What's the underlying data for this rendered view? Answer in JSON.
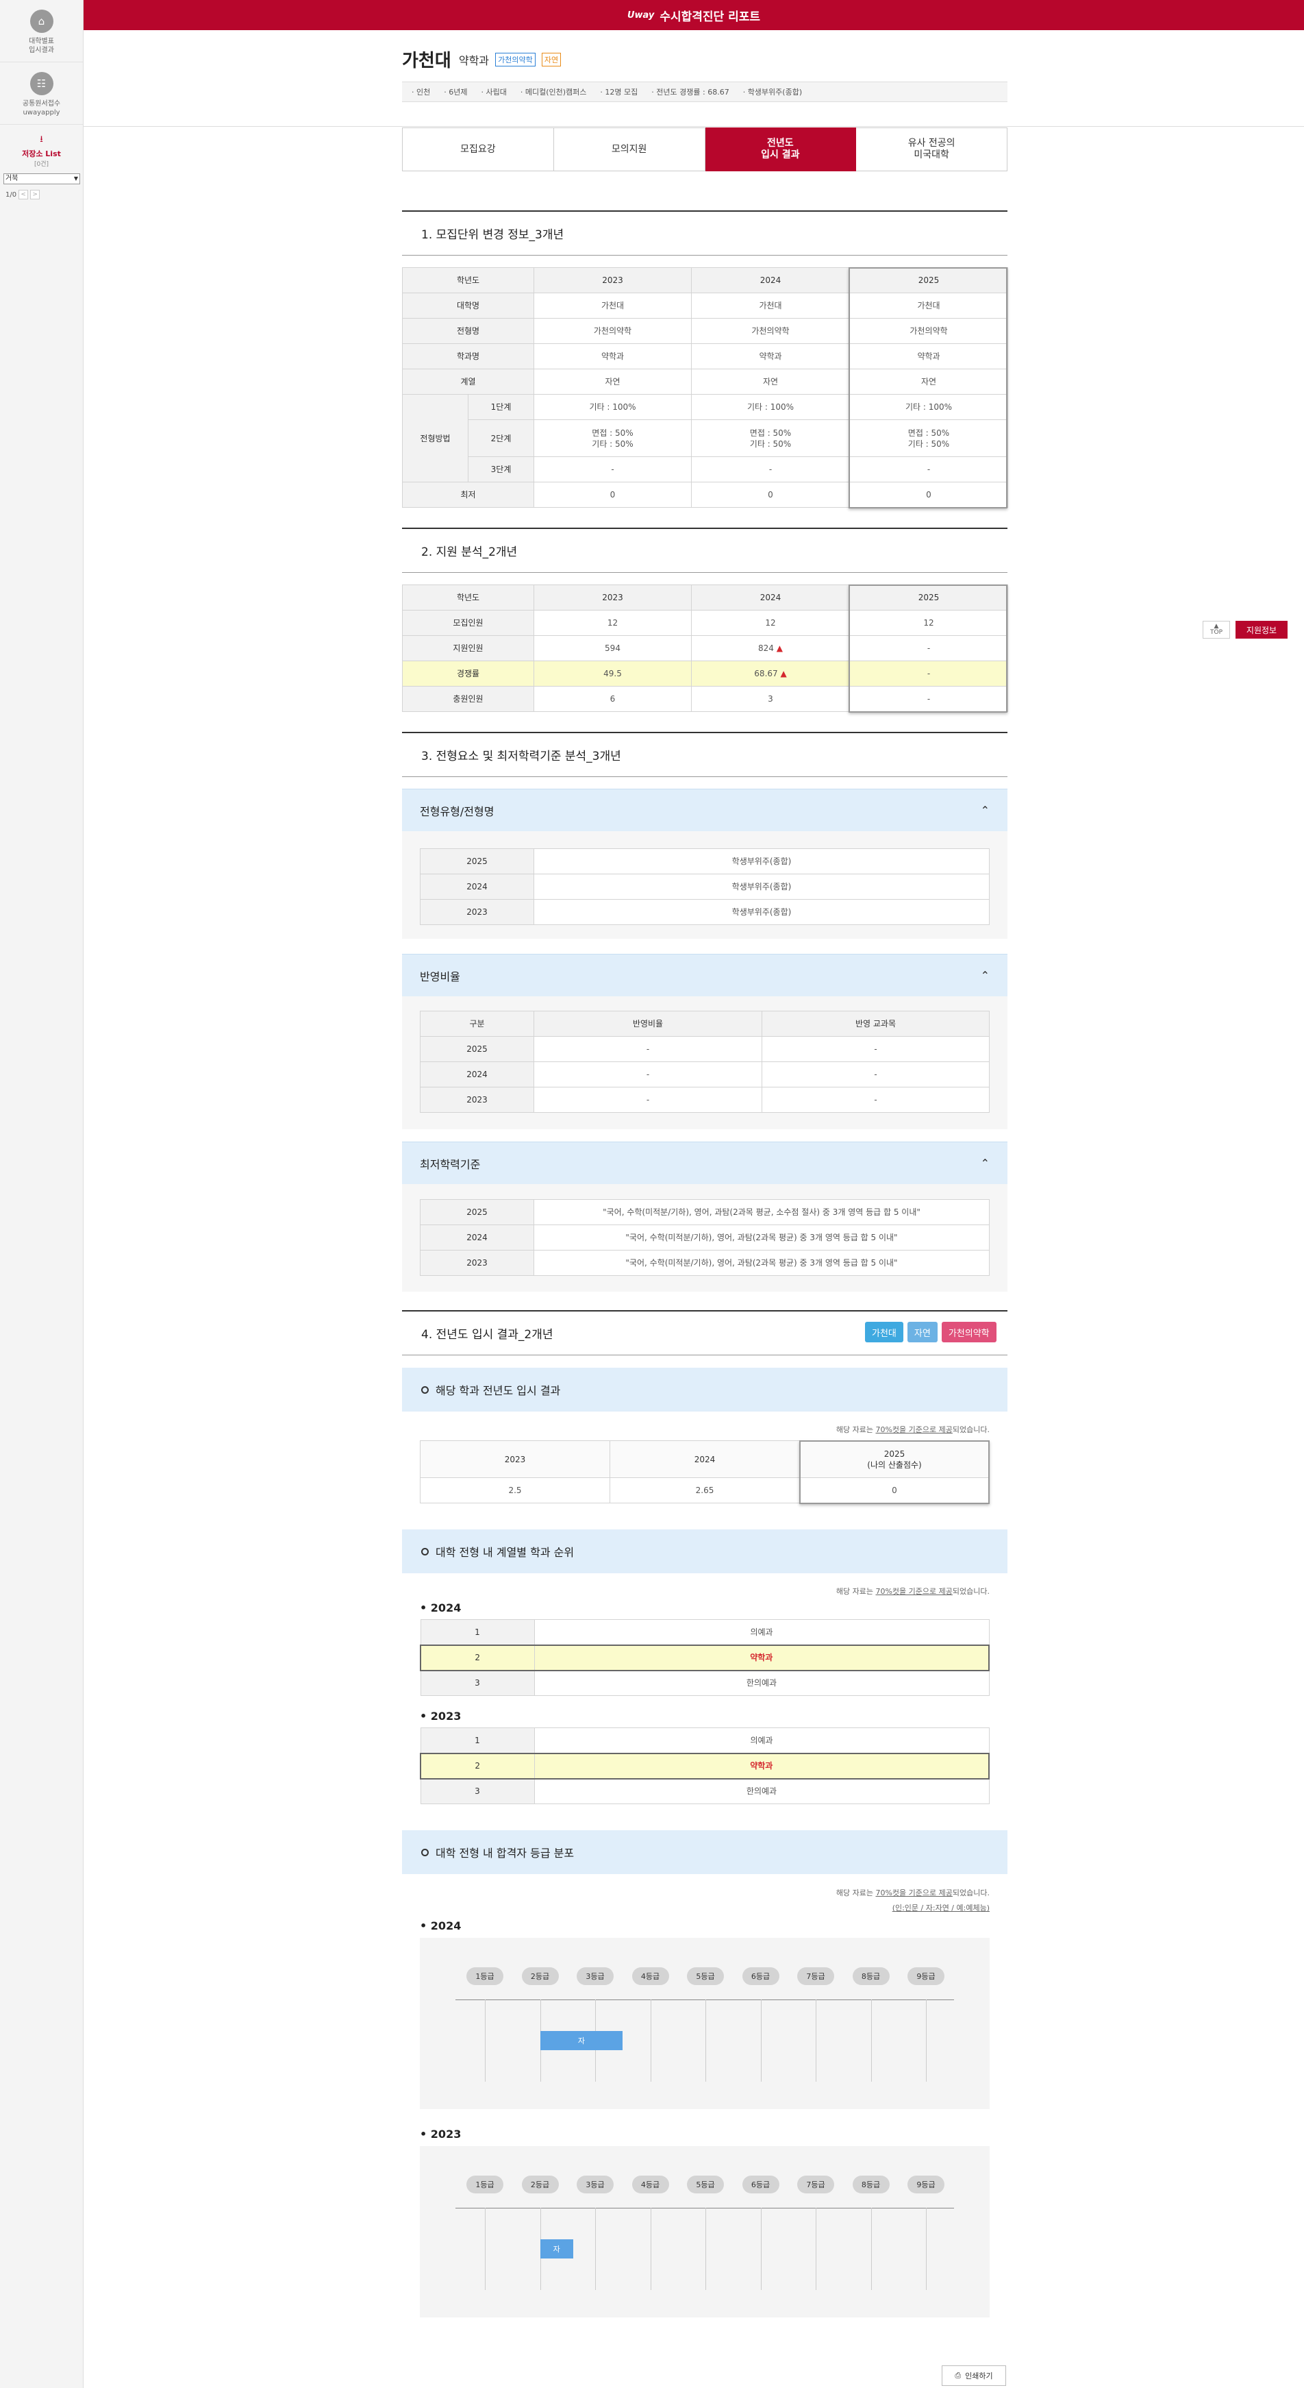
{
  "sidebar": {
    "items": [
      {
        "label": "대학별표\n입시결과",
        "icon": "school-icon"
      },
      {
        "label": "공통원서접수\nuwayapply",
        "icon": "document-icon"
      }
    ],
    "list_label": "저장소 List",
    "list_sub": "[0건]",
    "select_value": "거북",
    "pager": "1/0"
  },
  "topbar": {
    "logo": "Uway",
    "title": "수시합격진단 리포트"
  },
  "header": {
    "univ": "가천대",
    "major": "약학과",
    "tag1": "가천의약학",
    "tag2": "자연",
    "info": [
      "인천",
      "6년제",
      "사립대",
      "메디컬(인천)캠퍼스",
      "12명 모집",
      "전년도 경쟁률 : 68.67",
      "학생부위주(종합)"
    ]
  },
  "tabs": [
    "모집요강",
    "모의지원",
    "전년도\n입시 결과",
    "유사 전공의\n미국대학"
  ],
  "side_buttons": {
    "top": "TOP",
    "apply": "지원정보"
  },
  "sec1": {
    "title": "1. 모집단위 변경 정보_3개년",
    "rows": [
      {
        "label": "학년도",
        "v": [
          "2023",
          "2024",
          "2025"
        ]
      },
      {
        "label": "대학명",
        "v": [
          "가천대",
          "가천대",
          "가천대"
        ]
      },
      {
        "label": "전형명",
        "v": [
          "가천의약학",
          "가천의약학",
          "가천의약학"
        ]
      },
      {
        "label": "학과명",
        "v": [
          "약학과",
          "약학과",
          "약학과"
        ]
      },
      {
        "label": "계열",
        "v": [
          "자연",
          "자연",
          "자연"
        ]
      }
    ],
    "method_label": "전형방법",
    "stages": [
      {
        "label": "1단계",
        "v": [
          "기타 : 100%",
          "기타 : 100%",
          "기타 : 100%"
        ]
      },
      {
        "label": "2단계",
        "v": [
          "면접 : 50%\n기타 : 50%",
          "면접 : 50%\n기타 : 50%",
          "면접 : 50%\n기타 : 50%"
        ]
      },
      {
        "label": "3단계",
        "v": [
          "-",
          "-",
          "-"
        ]
      }
    ],
    "min": {
      "label": "최저",
      "v": [
        "0",
        "0",
        "0"
      ]
    }
  },
  "sec2": {
    "title": "2. 지원 분석_2개년",
    "rows": [
      {
        "label": "학년도",
        "v": [
          "2023",
          "2024",
          "2025"
        ]
      },
      {
        "label": "모집인원",
        "v": [
          "12",
          "12",
          "12"
        ]
      },
      {
        "label": "지원인원",
        "v": [
          "594",
          "824 ▲",
          "-"
        ]
      },
      {
        "label": "경쟁률",
        "v": [
          "49.5",
          "68.67 ▲",
          "-"
        ]
      },
      {
        "label": "충원인원",
        "v": [
          "6",
          "3",
          "-"
        ]
      }
    ]
  },
  "sec3": {
    "title": "3. 전형요소 및 최저학력기준 분석_3개년",
    "acc1": {
      "title": "전형유형/전형명",
      "rows": [
        {
          "y": "2025",
          "v": "학생부위주(종합)"
        },
        {
          "y": "2024",
          "v": "학생부위주(종합)"
        },
        {
          "y": "2023",
          "v": "학생부위주(종합)"
        }
      ]
    },
    "acc2": {
      "title": "반영비율",
      "head": [
        "구분",
        "반영비율",
        "반영 교과목"
      ],
      "rows": [
        {
          "y": "2025",
          "a": "-",
          "b": "-"
        },
        {
          "y": "2024",
          "a": "-",
          "b": "-"
        },
        {
          "y": "2023",
          "a": "-",
          "b": "-"
        }
      ]
    },
    "acc3": {
      "title": "최저학력기준",
      "rows": [
        {
          "y": "2025",
          "v": "\"국어, 수학(미적분/기하), 영어, 과탐(2과목 평균, 소수점 절사) 중 3개 영역 등급 합 5 이내\""
        },
        {
          "y": "2024",
          "v": "\"국어, 수학(미적분/기하), 영어, 과탐(2과목 평균) 중 3개 영역 등급 합 5 이내\""
        },
        {
          "y": "2023",
          "v": "\"국어, 수학(미적분/기하), 영어, 과탐(2과목 평균) 중 3개 영역 등급 합 5 이내\""
        }
      ]
    }
  },
  "sec4": {
    "title": "4. 전년도 입시 결과_2개년",
    "buttons": [
      {
        "label": "가천대",
        "color": "#3fa9e0"
      },
      {
        "label": "자연",
        "color": "#6cb2e4"
      },
      {
        "label": "가천의약학",
        "color": "#e0507a"
      }
    ],
    "sub1": {
      "title": "해당 학과 전년도 입시 결과",
      "note_pre": "해당 자료는 ",
      "note_u": "70%컷을 기준으로 제공",
      "note_post": "되었습니다.",
      "head": [
        "2023",
        "2024",
        "2025\n(나의 산출점수)"
      ],
      "vals": [
        "2.5",
        "2.65",
        "0"
      ]
    },
    "sub2": {
      "title": "대학 전형 내 계열별 학과 순위",
      "y2024": {
        "label": "2024",
        "rows": [
          {
            "r": "1",
            "n": "의예과"
          },
          {
            "r": "2",
            "n": "약학과"
          },
          {
            "r": "3",
            "n": "한의예과"
          }
        ]
      },
      "y2023": {
        "label": "2023",
        "rows": [
          {
            "r": "1",
            "n": "의예과"
          },
          {
            "r": "2",
            "n": "약학과"
          },
          {
            "r": "3",
            "n": "한의예과"
          }
        ]
      }
    },
    "sub3": {
      "title": "대학 전형 내 합격자 등급 분포",
      "legend": "(인:인문 / 자:자연 / 예:예체능)",
      "grades": [
        "1등급",
        "2등급",
        "3등급",
        "4등급",
        "5등급",
        "6등급",
        "7등급",
        "8등급",
        "9등급"
      ],
      "y2024": {
        "label": "2024",
        "bar_label": "자",
        "range": [
          2.0,
          3.5
        ]
      },
      "y2023": {
        "label": "2023",
        "bar_label": "자",
        "range": [
          2.0,
          2.6
        ]
      }
    }
  },
  "print_label": "인쇄하기"
}
